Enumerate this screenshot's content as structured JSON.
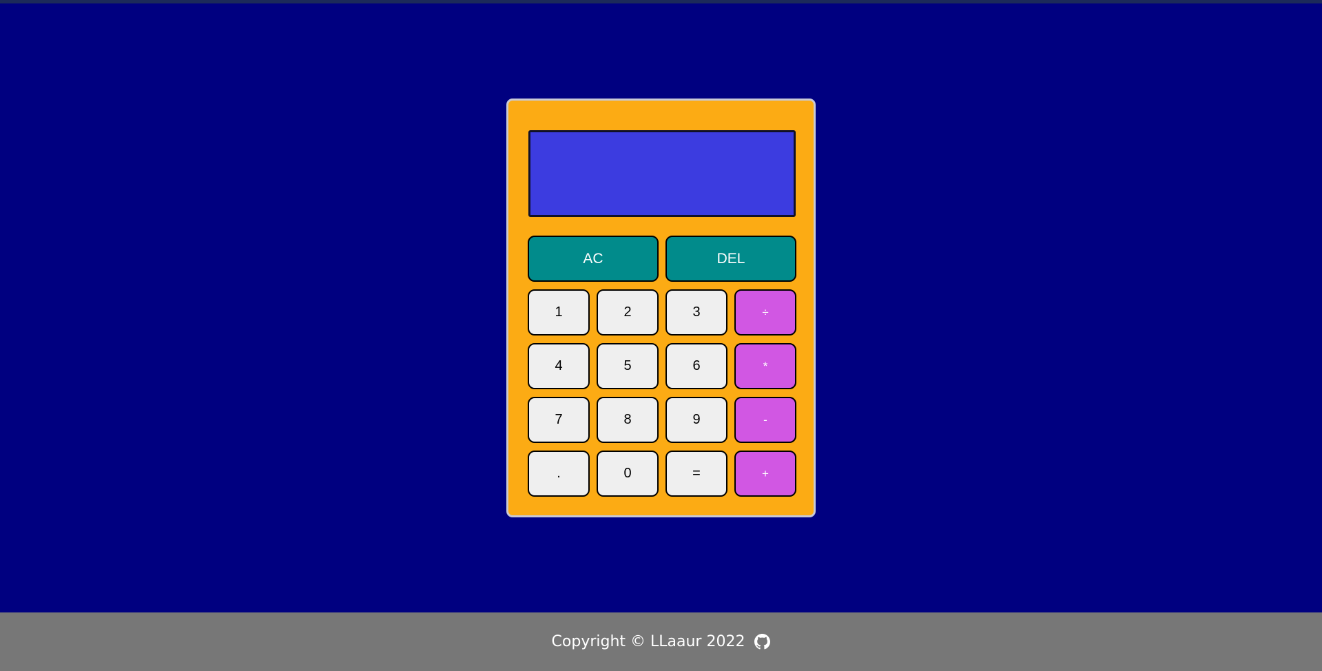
{
  "colors": {
    "page_background": "#000080",
    "calculator_body": "#fcab14",
    "display_background": "#3c3ce0",
    "number_key": "#efefef",
    "operator_key": "#d157e3",
    "control_key": "#018b8b",
    "footer_background": "#777777"
  },
  "display": {
    "value": ""
  },
  "controls": {
    "clear_label": "AC",
    "delete_label": "DEL"
  },
  "keys": {
    "one": "1",
    "two": "2",
    "three": "3",
    "divide": "÷",
    "four": "4",
    "five": "5",
    "six": "6",
    "multiply": "*",
    "seven": "7",
    "eight": "8",
    "nine": "9",
    "subtract": "-",
    "decimal": ".",
    "zero": "0",
    "equals": "=",
    "add": "+"
  },
  "footer": {
    "copyright": "Copyright © LLaaur 2022",
    "link_icon": "github-icon"
  }
}
